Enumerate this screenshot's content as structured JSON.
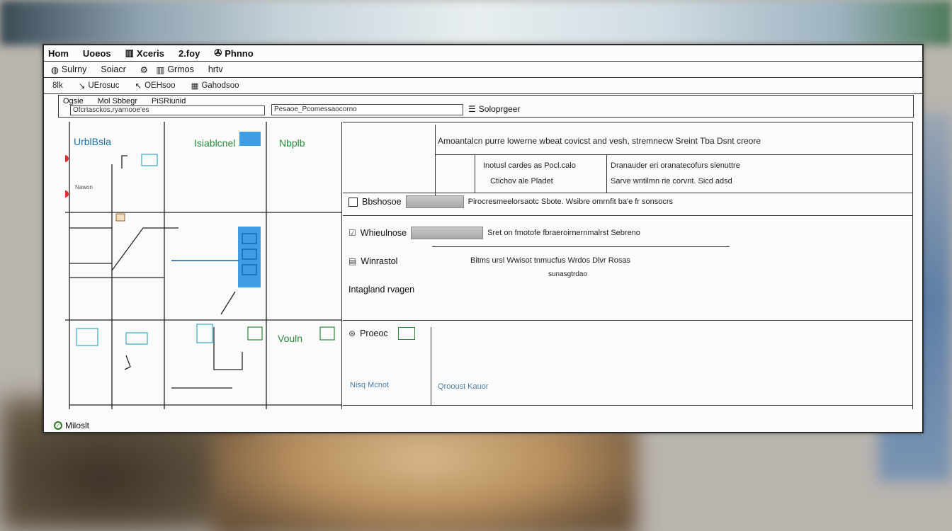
{
  "menu": [
    {
      "label": "Hom",
      "icon": ""
    },
    {
      "label": "Uoeos",
      "icon": ""
    },
    {
      "label": "Xceris",
      "icon": "grid-icon"
    },
    {
      "label": "2.foy",
      "icon": ""
    },
    {
      "label": "Phnno",
      "icon": "tool-icon"
    }
  ],
  "toolbar1": [
    {
      "label": "Sulrny",
      "icon": "circle-icon"
    },
    {
      "label": "Soiacr",
      "icon": ""
    },
    {
      "label": "Grmos",
      "icon": "gear-icon"
    },
    {
      "label": "hrtv",
      "icon": ""
    }
  ],
  "toolbar2": [
    {
      "label": "8lk",
      "icon": ""
    },
    {
      "label": "UErosuc",
      "icon": "arrow-icon"
    },
    {
      "label": "OEHsoo",
      "icon": "cursor-icon"
    },
    {
      "label": "Gahodsoo",
      "icon": "grid-icon"
    }
  ],
  "pathbar": {
    "crumbs": [
      "Ogsie",
      "Mol Sbbegr",
      "PiSRiunid"
    ],
    "field1": "Ofcrtasckos,ryarnooe'es",
    "field2": "Pesaoe_Pcomessaocorno",
    "right_label": "Soloprgeer"
  },
  "diagram": {
    "labels": [
      {
        "text": "UrblBsla",
        "color": "blue"
      },
      {
        "text": "Isiablcnel",
        "color": "green"
      },
      {
        "text": "Nbplb",
        "color": "green"
      },
      {
        "text": "Vouln",
        "color": "green"
      }
    ],
    "side_label": "Nawon"
  },
  "properties": {
    "header_right": "Amoantalcn purre lowerne wbeat covicst and vesh, stremnecw Sreint Tba Dsnt creore",
    "row1": {
      "label": "Bbshosoe",
      "subrows": [
        {
          "left": "Inotusl cardes as Pocl.calo",
          "right": "Dranauder eri oranatecofurs sienuttre"
        },
        {
          "left": "Ctichov ale Pladet",
          "right": "Sarve wntilmn rie corvnt. Sicd adsd"
        }
      ]
    },
    "row2": {
      "label": "Whieulnose",
      "desc": "Pirocresmeelorsaotc Sbote. Wsibre omrnfit ba'e fr sonsocrs"
    },
    "row3": {
      "label": "Winrastol",
      "desc": "Sret on fmotofe fbraeroirnernmalrst Sebreno"
    },
    "row4": {
      "label": "Intagland rvagen",
      "desc": "Bitms ursl Wwisot tnmucfus Wrdos Dlvr Rosas",
      "sub": "sunasgtrdao"
    },
    "row5": {
      "label": "Proeoc"
    },
    "footer_left": "Nisq Mcnot",
    "footer_right": "Qrooust Kauor"
  },
  "status": {
    "label": "Miloslt"
  }
}
